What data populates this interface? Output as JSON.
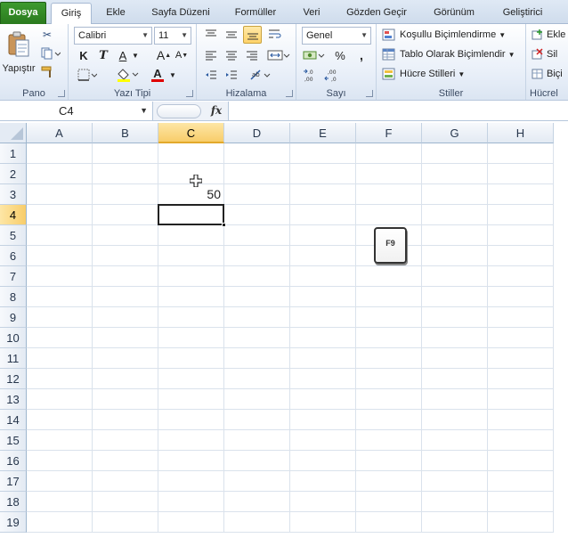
{
  "tabs": [
    "Dosya",
    "Giriş",
    "Ekle",
    "Sayfa Düzeni",
    "Formüller",
    "Veri",
    "Gözden Geçir",
    "Görünüm",
    "Geliştirici"
  ],
  "ribbon": {
    "pano": {
      "label": "Pano",
      "paste_label": "Yapıştır"
    },
    "font": {
      "label": "Yazı Tipi",
      "font_name": "Calibri",
      "font_size": "11",
      "bold": "K",
      "italic": "T",
      "underline": "A",
      "grow": "A",
      "shrink": "A",
      "font_color": "A"
    },
    "align": {
      "label": "Hizalama"
    },
    "number": {
      "label": "Sayı",
      "format": "Genel",
      "percent": "%",
      "comma": ","
    },
    "styles": {
      "label": "Stiller",
      "conditional": "Koşullu Biçimlendirme",
      "table": "Tablo Olarak Biçimlendir",
      "cell_styles": "Hücre Stilleri"
    },
    "cells": {
      "label": "Hücrel",
      "insert": "Ekle",
      "delete": "Sil",
      "format": "Biçi"
    }
  },
  "formula_bar": {
    "name_box": "C4",
    "fx": "fx",
    "value": ""
  },
  "grid": {
    "columns": [
      "A",
      "B",
      "C",
      "D",
      "E",
      "F",
      "G",
      "H"
    ],
    "rows": [
      "1",
      "2",
      "3",
      "4",
      "5",
      "6",
      "7",
      "8",
      "9",
      "10",
      "11",
      "12",
      "13",
      "14",
      "15",
      "16",
      "17",
      "18",
      "19"
    ],
    "selected_column": "C",
    "selected_row": "4",
    "cells": {
      "C3": "50"
    }
  },
  "keycap": {
    "label": "F9"
  }
}
